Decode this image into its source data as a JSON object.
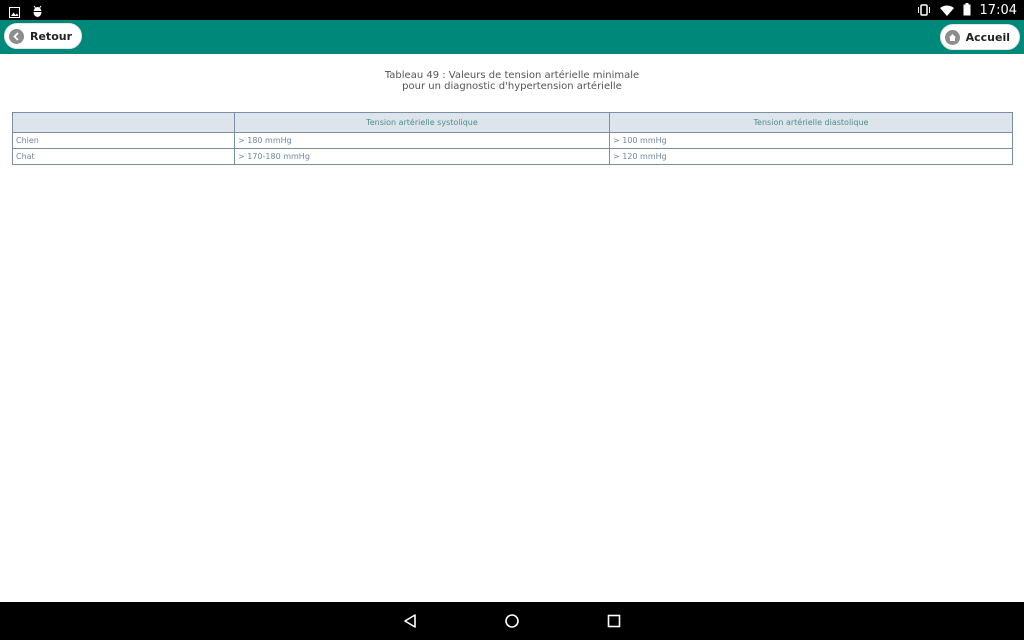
{
  "status_bar": {
    "time": "17:04"
  },
  "toolbar": {
    "back_label": "Retour",
    "home_label": "Accueil"
  },
  "caption": {
    "line1": "Tableau 49 : Valeurs de tension artérielle minimale",
    "line2": "pour un diagnostic d'hypertension artérielle"
  },
  "table": {
    "headers": [
      "",
      "Tension artérielle systolique",
      "Tension artérielle diastolique"
    ],
    "rows": [
      [
        "Chien",
        "> 180 mmHg",
        "> 100 mmHg"
      ],
      [
        "Chat",
        "> 170-180 mmHg",
        "> 120 mmHg"
      ]
    ]
  },
  "colors": {
    "toolbar": "#00897b",
    "header_bg": "#dde4eb",
    "header_text": "#4d8e8e",
    "cell_text": "#6f88a0"
  }
}
